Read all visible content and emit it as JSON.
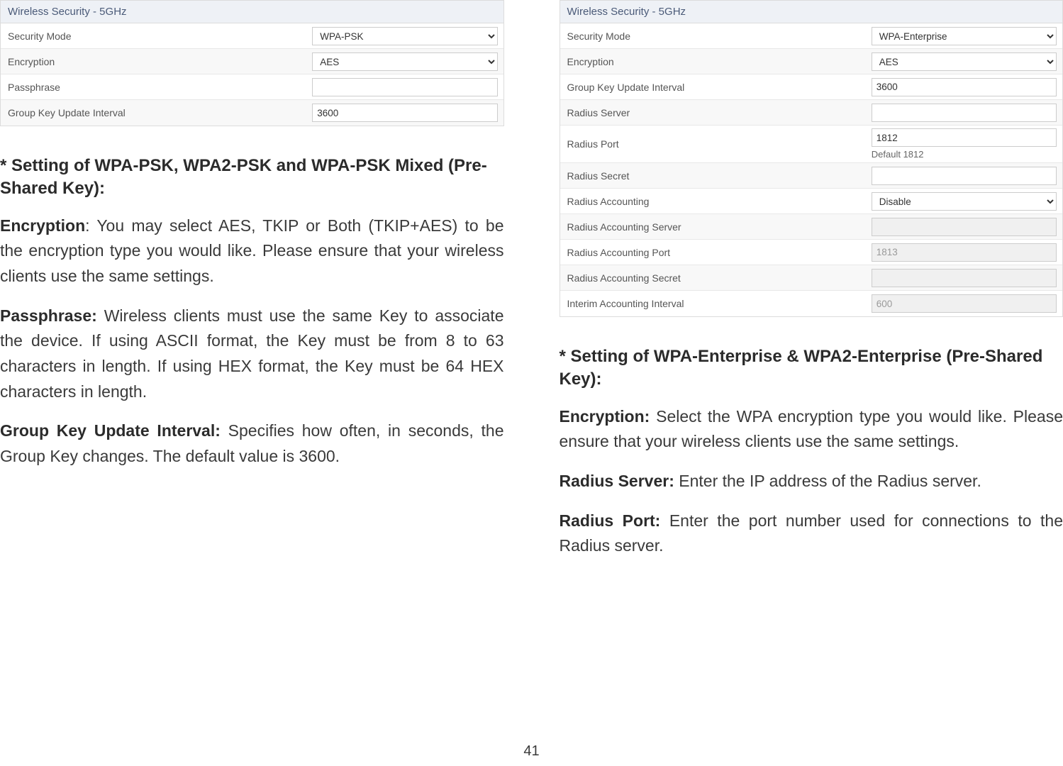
{
  "left": {
    "panel_title": "Wireless Security - 5GHz",
    "rows": [
      {
        "label": "Security Mode",
        "type": "select",
        "value": "WPA-PSK"
      },
      {
        "label": "Encryption",
        "type": "select",
        "value": "AES"
      },
      {
        "label": "Passphrase",
        "type": "text",
        "value": ""
      },
      {
        "label": "Group Key Update Interval",
        "type": "text",
        "value": "3600"
      }
    ],
    "heading": "* Setting of WPA-PSK, WPA2-PSK and WPA-PSK Mixed (Pre-Shared Key):",
    "para_encryption_label": "Encryption",
    "para_encryption_text": ": You may select AES, TKIP or Both (TKIP+AES) to be the encryption type you would like. Please ensure that your wireless clients use the same settings.",
    "para_passphrase_label": "Passphrase:",
    "para_passphrase_text": " Wireless clients must use the same Key to associate the device. If using ASCII format, the Key must be from 8 to 63 characters in length. If using HEX format, the Key must be 64 HEX characters in length.",
    "para_gkui_label": "Group Key Update Interval:",
    "para_gkui_text": " Specifies how often, in seconds, the Group Key changes. The default value is 3600."
  },
  "right": {
    "panel_title": "Wireless Security - 5GHz",
    "rows": [
      {
        "label": "Security Mode",
        "type": "select",
        "value": "WPA-Enterprise"
      },
      {
        "label": "Encryption",
        "type": "select",
        "value": "AES"
      },
      {
        "label": "Group Key Update Interval",
        "type": "text",
        "value": "3600"
      },
      {
        "label": "Radius Server",
        "type": "text",
        "value": ""
      },
      {
        "label": "Radius Port",
        "type": "text",
        "value": "1812",
        "hint": "Default 1812"
      },
      {
        "label": "Radius Secret",
        "type": "text",
        "value": ""
      },
      {
        "label": "Radius Accounting",
        "type": "select",
        "value": "Disable"
      },
      {
        "label": "Radius Accounting Server",
        "type": "text",
        "value": "",
        "disabled": true
      },
      {
        "label": "Radius Accounting Port",
        "type": "text",
        "value": "",
        "placeholder": "1813",
        "disabled": true
      },
      {
        "label": "Radius Accounting Secret",
        "type": "text",
        "value": "",
        "disabled": true
      },
      {
        "label": "Interim Accounting Interval",
        "type": "text",
        "value": "",
        "placeholder": "600",
        "disabled": true
      }
    ],
    "heading": "* Setting of WPA-Enterprise & WPA2-Enterprise (Pre-Shared Key):",
    "para_encryption_label": "Encryption:",
    "para_encryption_text": " Select the WPA encryption type you would like. Please ensure that your wireless clients use the same settings.",
    "para_rs_label": "Radius Server:",
    "para_rs_text": " Enter the IP address of the Radius server.",
    "para_rp_label": "Radius Port:",
    "para_rp_text": " Enter the port number used for connections to the Radius server."
  },
  "page_number": "41"
}
